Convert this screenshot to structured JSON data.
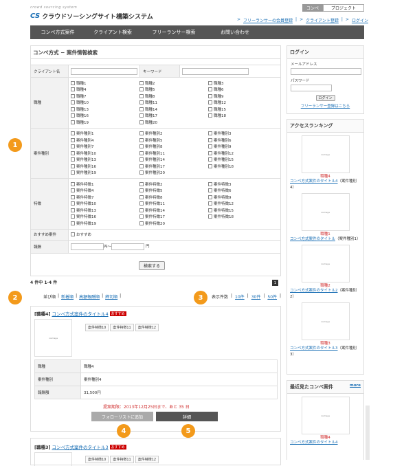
{
  "header": {
    "logo_sub": "crowd sourcing system",
    "logo_mark": "CS",
    "logo_text": "クラウドソーシングサイト構築システム",
    "btn_conpe": "コンペ",
    "btn_project": "プロジェクト",
    "links": [
      "フリーランサーの会員登録",
      "クライアント登録",
      "ログイン"
    ]
  },
  "nav": [
    "コンペ方式案件",
    "クライアント検索",
    "フリーランサー検索",
    "お問い合わせ"
  ],
  "search": {
    "title": "コンペ方式 − 案件情報検索",
    "client_label": "クライアント名",
    "keyword_label": "キーワード",
    "job_label": "職種",
    "jobs": [
      "職種1",
      "職種2",
      "職種3",
      "職種4",
      "職種5",
      "職種6",
      "職種7",
      "職種8",
      "職種9",
      "職種10",
      "職種11",
      "職種12",
      "職種13",
      "職種14",
      "職種15",
      "職種16",
      "職種17",
      "職種18",
      "職種19",
      "職種20"
    ],
    "type_label": "案件種別",
    "types": [
      "案件種別1",
      "案件種別2",
      "案件種別3",
      "案件種別4",
      "案件種別5",
      "案件種別6",
      "案件種別7",
      "案件種別8",
      "案件種別9",
      "案件種別10",
      "案件種別11",
      "案件種別12",
      "案件種別13",
      "案件種別14",
      "案件種別15",
      "案件種別16",
      "案件種別17",
      "案件種別18",
      "案件種別19",
      "案件種別20"
    ],
    "feature_label": "特徴",
    "features": [
      "案件特徴1",
      "案件特徴2",
      "案件特徴3",
      "案件特徴4",
      "案件特徴5",
      "案件特徴6",
      "案件特徴7",
      "案件特徴8",
      "案件特徴9",
      "案件特徴10",
      "案件特徴11",
      "案件特徴12",
      "案件特徴13",
      "案件特徴14",
      "案件特徴15",
      "案件特徴16",
      "案件特徴17",
      "案件特徴18",
      "案件特徴19",
      "案件特徴20"
    ],
    "recommend_label": "おすすめ案件",
    "recommend_check": "おすすめ",
    "reward_label": "報酬",
    "reward_from_unit": "円〜",
    "reward_to_unit": "円",
    "search_button": "検索する"
  },
  "results": {
    "count": "4 件中 1-4 件",
    "page": "1",
    "sort_label": "並び順",
    "sort_options": [
      "新着順",
      "高額報酬順",
      "締切順"
    ],
    "display_label": "表示件数",
    "display_options": [
      "10件",
      "30件",
      "50件"
    ]
  },
  "items": [
    {
      "category": "[職種4]",
      "title": "コンペ方式案件のタイトル4",
      "badge": "おすすめ",
      "thumb_text": "noimage",
      "tags": [
        "案件特徴10",
        "案件特徴11",
        "案件特徴12"
      ],
      "rows": [
        {
          "label": "職種",
          "value": "職種4"
        },
        {
          "label": "案件種別",
          "value": "案件種別4"
        },
        {
          "label": "報酬額",
          "value": "31,500円"
        }
      ],
      "deadline": "提案期限：2013年12月25日まで、あと 35 日",
      "follow_button": "フォローリストに追加",
      "detail_button": "詳細"
    },
    {
      "category": "[職種3]",
      "title": "コンペ方式案件のタイトル3",
      "badge": "おすすめ",
      "tags": [
        "案件特徴10",
        "案件特徴11",
        "案件特徴12"
      ]
    }
  ],
  "markers": [
    "1",
    "2",
    "3",
    "4",
    "5"
  ],
  "login": {
    "title": "ログイン",
    "email_label": "メールアドレス",
    "password_label": "パスワード",
    "button": "ログイン",
    "register_link": "フリーランサー登録はこちら"
  },
  "ranking": {
    "title": "アクセスランキング",
    "entries": [
      {
        "thumb": "noimage",
        "cat": "職種4",
        "title": "コンペ方式案件のタイトル4",
        "type": "（案件種別4）"
      },
      {
        "thumb": "noimage",
        "cat": "職種1",
        "title": "コンペ方式案件のタイトル",
        "type": "（案件種別1）"
      },
      {
        "thumb": "noimage",
        "cat": "職種2",
        "title": "コンペ方式案件のタイトル2",
        "type": "（案件種別2）"
      },
      {
        "thumb": "noimage",
        "cat": "職種3",
        "title": "コンペ方式案件のタイトル3",
        "type": "（案件種別3）"
      }
    ]
  },
  "recent": {
    "title": "最近見たコンペ案件",
    "more": "more",
    "entry": {
      "thumb": "noimage",
      "cat": "職種4",
      "title": "コンペ方式案件のタイトル4"
    }
  }
}
